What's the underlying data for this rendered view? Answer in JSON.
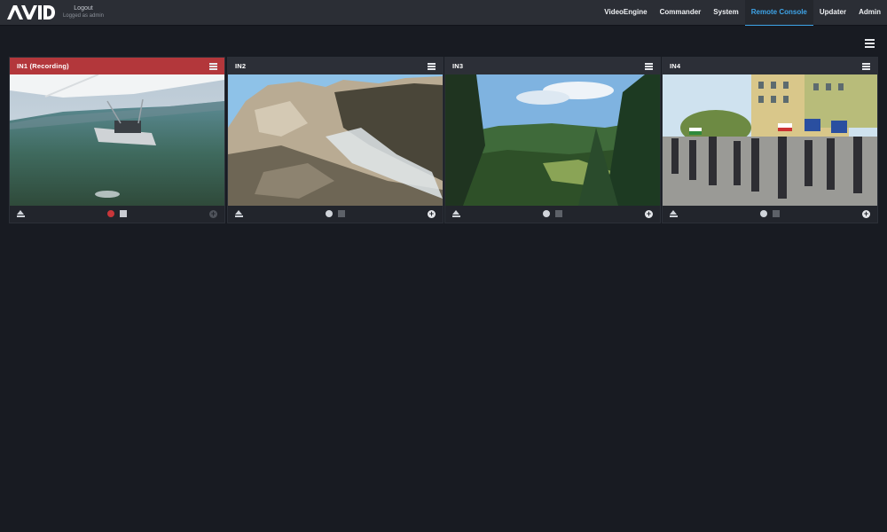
{
  "header": {
    "brand": "AVID",
    "logout_label": "Logout",
    "logged_as": "Logged as admin",
    "nav": [
      {
        "label": "VideoEngine",
        "active": false
      },
      {
        "label": "Commander",
        "active": false
      },
      {
        "label": "System",
        "active": false
      },
      {
        "label": "Remote Console",
        "active": true
      },
      {
        "label": "Updater",
        "active": false
      },
      {
        "label": "Admin",
        "active": false
      }
    ]
  },
  "colors": {
    "accent": "#3ea4e8",
    "recording": "#b3373b",
    "record_active": "#c8363a",
    "record_idle": "#d0d4da",
    "stop_active": "#c9ccd2",
    "stop_idle": "#5d6168"
  },
  "icons": {
    "page_menu": "hamburger-icon",
    "panel_menu": "hamburger-icon",
    "eject": "eject-icon",
    "record": "record-icon",
    "stop": "stop-icon",
    "add": "plus-circle-icon"
  },
  "panels": [
    {
      "title": "IN1 (Recording)",
      "recording": true,
      "scene": "airplane over lake"
    },
    {
      "title": "IN2",
      "recording": false,
      "scene": "rock formation"
    },
    {
      "title": "IN3",
      "recording": false,
      "scene": "forest valley"
    },
    {
      "title": "IN4",
      "recording": false,
      "scene": "street crowd with flags"
    }
  ]
}
